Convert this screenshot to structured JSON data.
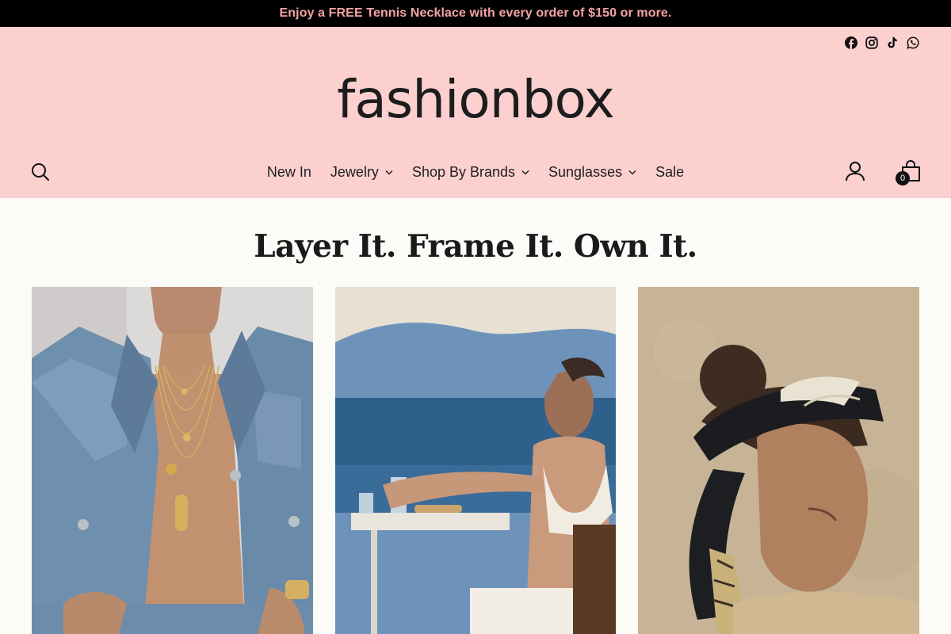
{
  "announcement": "Enjoy a FREE Tennis Necklace with every order of $150 or more.",
  "logo": "fashionbox",
  "social_icons": [
    "facebook-icon",
    "instagram-icon",
    "tiktok-icon",
    "whatsapp-icon"
  ],
  "nav": {
    "items": [
      {
        "label": "New In",
        "has_dropdown": false
      },
      {
        "label": "Jewelry",
        "has_dropdown": true
      },
      {
        "label": "Shop By Brands",
        "has_dropdown": true
      },
      {
        "label": "Sunglasses",
        "has_dropdown": true
      },
      {
        "label": "Sale",
        "has_dropdown": false
      }
    ]
  },
  "cart": {
    "count": "0"
  },
  "section": {
    "heading": "Layer It. Frame It. Own It."
  },
  "colors": {
    "announcement_bg": "#000000",
    "announcement_text": "#f4a3a3",
    "header_bg": "#fdd0d0",
    "page_bg": "#fbfbf7"
  }
}
